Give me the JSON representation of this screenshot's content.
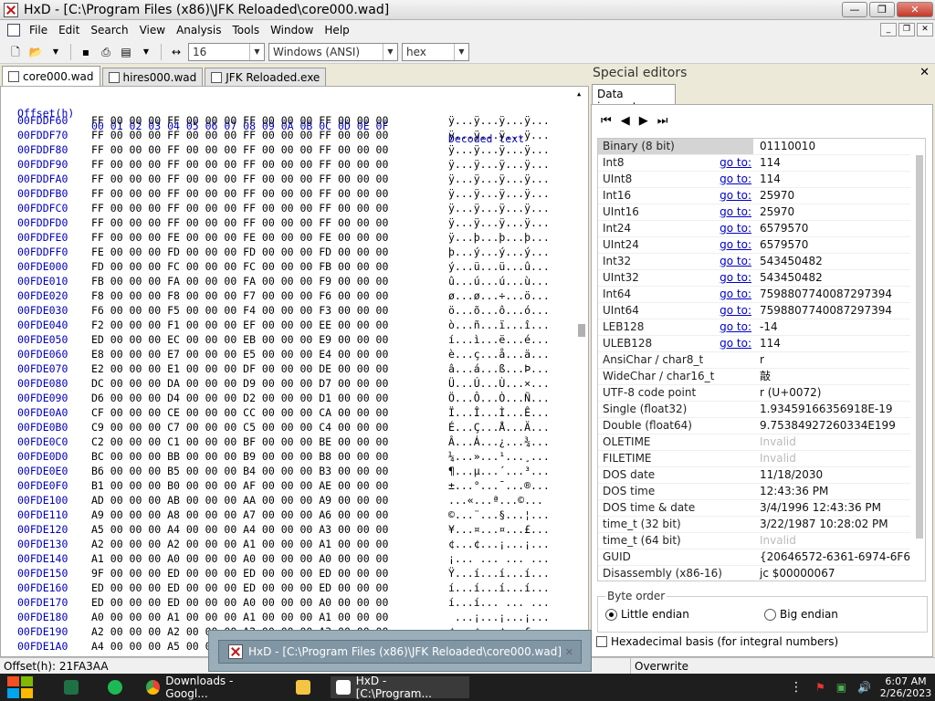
{
  "window": {
    "title": "HxD - [C:\\Program Files (x86)\\JFK Reloaded\\core000.wad]"
  },
  "menu": [
    "File",
    "Edit",
    "Search",
    "View",
    "Analysis",
    "Tools",
    "Window",
    "Help"
  ],
  "toolbar": {
    "bytes_per_row": "16",
    "charset": "Windows (ANSI)",
    "offset_base": "hex"
  },
  "tabs": [
    "core000.wad",
    "hires000.wad",
    "JFK Reloaded.exe"
  ],
  "hex": {
    "header_offset": "Offset(h)",
    "header_columns": "00 01 02 03 04 05 06 07 08 09 0A 0B 0C 0D 0E 0F",
    "header_decoded": "Decoded text",
    "rows": [
      {
        "o": "00FDDF60",
        "b": "FF 00 00 00 FF 00 00 00 FF 00 00 00 FF 00 00 00",
        "d": "ÿ...ÿ...ÿ...ÿ..."
      },
      {
        "o": "00FDDF70",
        "b": "FF 00 00 00 FF 00 00 00 FF 00 00 00 FF 00 00 00",
        "d": "ÿ...ÿ...ÿ...ÿ..."
      },
      {
        "o": "00FDDF80",
        "b": "FF 00 00 00 FF 00 00 00 FF 00 00 00 FF 00 00 00",
        "d": "ÿ...ÿ...ÿ...ÿ..."
      },
      {
        "o": "00FDDF90",
        "b": "FF 00 00 00 FF 00 00 00 FF 00 00 00 FF 00 00 00",
        "d": "ÿ...ÿ...ÿ...ÿ..."
      },
      {
        "o": "00FDDFA0",
        "b": "FF 00 00 00 FF 00 00 00 FF 00 00 00 FF 00 00 00",
        "d": "ÿ...ÿ...ÿ...ÿ..."
      },
      {
        "o": "00FDDFB0",
        "b": "FF 00 00 00 FF 00 00 00 FF 00 00 00 FF 00 00 00",
        "d": "ÿ...ÿ...ÿ...ÿ..."
      },
      {
        "o": "00FDDFC0",
        "b": "FF 00 00 00 FF 00 00 00 FF 00 00 00 FF 00 00 00",
        "d": "ÿ...ÿ...ÿ...ÿ..."
      },
      {
        "o": "00FDDFD0",
        "b": "FF 00 00 00 FF 00 00 00 FF 00 00 00 FF 00 00 00",
        "d": "ÿ...ÿ...ÿ...ÿ..."
      },
      {
        "o": "00FDDFE0",
        "b": "FF 00 00 00 FE 00 00 00 FE 00 00 00 FE 00 00 00",
        "d": "ÿ...þ...þ...þ..."
      },
      {
        "o": "00FDDFF0",
        "b": "FE 00 00 00 FD 00 00 00 FD 00 00 00 FD 00 00 00",
        "d": "þ...ý...ý...ý..."
      },
      {
        "o": "00FDE000",
        "b": "FD 00 00 00 FC 00 00 00 FC 00 00 00 FB 00 00 00",
        "d": "ý...ü...ü...û..."
      },
      {
        "o": "00FDE010",
        "b": "FB 00 00 00 FA 00 00 00 FA 00 00 00 F9 00 00 00",
        "d": "û...ú...ú...ù..."
      },
      {
        "o": "00FDE020",
        "b": "F8 00 00 00 F8 00 00 00 F7 00 00 00 F6 00 00 00",
        "d": "ø...ø...÷...ö..."
      },
      {
        "o": "00FDE030",
        "b": "F6 00 00 00 F5 00 00 00 F4 00 00 00 F3 00 00 00",
        "d": "ö...õ...ô...ó..."
      },
      {
        "o": "00FDE040",
        "b": "F2 00 00 00 F1 00 00 00 EF 00 00 00 EE 00 00 00",
        "d": "ò...ñ...ï...î..."
      },
      {
        "o": "00FDE050",
        "b": "ED 00 00 00 EC 00 00 00 EB 00 00 00 E9 00 00 00",
        "d": "í...ì...ë...é..."
      },
      {
        "o": "00FDE060",
        "b": "E8 00 00 00 E7 00 00 00 E5 00 00 00 E4 00 00 00",
        "d": "è...ç...å...ä..."
      },
      {
        "o": "00FDE070",
        "b": "E2 00 00 00 E1 00 00 00 DF 00 00 00 DE 00 00 00",
        "d": "â...á...ß...Þ..."
      },
      {
        "o": "00FDE080",
        "b": "DC 00 00 00 DA 00 00 00 D9 00 00 00 D7 00 00 00",
        "d": "Ü...Ú...Ù...×..."
      },
      {
        "o": "00FDE090",
        "b": "D6 00 00 00 D4 00 00 00 D2 00 00 00 D1 00 00 00",
        "d": "Ö...Ô...Ò...Ñ..."
      },
      {
        "o": "00FDE0A0",
        "b": "CF 00 00 00 CE 00 00 00 CC 00 00 00 CA 00 00 00",
        "d": "Ï...Î...Ì...Ê..."
      },
      {
        "o": "00FDE0B0",
        "b": "C9 00 00 00 C7 00 00 00 C5 00 00 00 C4 00 00 00",
        "d": "É...Ç...Å...Ä..."
      },
      {
        "o": "00FDE0C0",
        "b": "C2 00 00 00 C1 00 00 00 BF 00 00 00 BE 00 00 00",
        "d": "Â...Á...¿...¾..."
      },
      {
        "o": "00FDE0D0",
        "b": "BC 00 00 00 BB 00 00 00 B9 00 00 00 B8 00 00 00",
        "d": "¼...»...¹...¸..."
      },
      {
        "o": "00FDE0E0",
        "b": "B6 00 00 00 B5 00 00 00 B4 00 00 00 B3 00 00 00",
        "d": "¶...µ...´...³..."
      },
      {
        "o": "00FDE0F0",
        "b": "B1 00 00 00 B0 00 00 00 AF 00 00 00 AE 00 00 00",
        "d": "±...°...¯...®..."
      },
      {
        "o": "00FDE100",
        "b": "AD 00 00 00 AB 00 00 00 AA 00 00 00 A9 00 00 00",
        "d": "­...«...ª...©..."
      },
      {
        "o": "00FDE110",
        "b": "A9 00 00 00 A8 00 00 00 A7 00 00 00 A6 00 00 00",
        "d": "©...¨...§...¦..."
      },
      {
        "o": "00FDE120",
        "b": "A5 00 00 00 A4 00 00 00 A4 00 00 00 A3 00 00 00",
        "d": "¥...¤...¤...£..."
      },
      {
        "o": "00FDE130",
        "b": "A2 00 00 00 A2 00 00 00 A1 00 00 00 A1 00 00 00",
        "d": "¢...¢...¡...¡..."
      },
      {
        "o": "00FDE140",
        "b": "A1 00 00 00 A0 00 00 00 A0 00 00 00 A0 00 00 00",
        "d": "¡... ... ... ..."
      },
      {
        "o": "00FDE150",
        "b": "9F 00 00 00 ED 00 00 00 ED 00 00 00 ED 00 00 00",
        "d": "Ÿ...í...í...í..."
      },
      {
        "o": "00FDE160",
        "b": "ED 00 00 00 ED 00 00 00 ED 00 00 00 ED 00 00 00",
        "d": "í...í...í...í..."
      },
      {
        "o": "00FDE170",
        "b": "ED 00 00 00 ED 00 00 00 A0 00 00 00 A0 00 00 00",
        "d": "í...í... ... ..."
      },
      {
        "o": "00FDE180",
        "b": "A0 00 00 00 A1 00 00 00 A1 00 00 00 A1 00 00 00",
        "d": " ...¡...¡...¡..."
      },
      {
        "o": "00FDE190",
        "b": "A2 00 00 00 A2 00 00 00 A2 00 00 00 A3 00 00 00",
        "d": "¢...¢...¢...£..."
      },
      {
        "o": "00FDE1A0",
        "b": "A4 00 00 00 A5 00 00 00 A5 00 00 00 A6 00 00 00",
        "d": "¤...¥...¥...¦..."
      }
    ]
  },
  "special_editors": {
    "title": "Special editors",
    "tab": "Data inspector",
    "goto_label": "go to:",
    "rows": [
      {
        "name": "Binary (8 bit)",
        "value": "01110010",
        "goto": false
      },
      {
        "name": "Int8",
        "value": "114",
        "goto": true
      },
      {
        "name": "UInt8",
        "value": "114",
        "goto": true
      },
      {
        "name": "Int16",
        "value": "25970",
        "goto": true
      },
      {
        "name": "UInt16",
        "value": "25970",
        "goto": true
      },
      {
        "name": "Int24",
        "value": "6579570",
        "goto": true
      },
      {
        "name": "UInt24",
        "value": "6579570",
        "goto": true
      },
      {
        "name": "Int32",
        "value": "543450482",
        "goto": true
      },
      {
        "name": "UInt32",
        "value": "543450482",
        "goto": true
      },
      {
        "name": "Int64",
        "value": "7598807740087297394",
        "goto": true
      },
      {
        "name": "UInt64",
        "value": "7598807740087297394",
        "goto": true
      },
      {
        "name": "LEB128",
        "value": "-14",
        "goto": true
      },
      {
        "name": "ULEB128",
        "value": "114",
        "goto": true
      },
      {
        "name": "AnsiChar / char8_t",
        "value": "r",
        "goto": false
      },
      {
        "name": "WideChar / char16_t",
        "value": "敲",
        "goto": false
      },
      {
        "name": "UTF-8 code point",
        "value": "r (U+0072)",
        "goto": false
      },
      {
        "name": "Single (float32)",
        "value": "1.93459166356918E-19",
        "goto": false
      },
      {
        "name": "Double (float64)",
        "value": "9.75384927260334E199",
        "goto": false
      },
      {
        "name": "OLETIME",
        "value": "Invalid",
        "goto": false,
        "dim": true
      },
      {
        "name": "FILETIME",
        "value": "Invalid",
        "goto": false,
        "dim": true
      },
      {
        "name": "DOS date",
        "value": "11/18/2030",
        "goto": false
      },
      {
        "name": "DOS time",
        "value": "12:43:36 PM",
        "goto": false
      },
      {
        "name": "DOS time & date",
        "value": "3/4/1996 12:43:36 PM",
        "goto": false
      },
      {
        "name": "time_t (32 bit)",
        "value": "3/22/1987 10:28:02 PM",
        "goto": false
      },
      {
        "name": "time_t (64 bit)",
        "value": "Invalid",
        "goto": false,
        "dim": true
      },
      {
        "name": "GUID",
        "value": "{20646572-6361-6974-6F6E-",
        "goto": false
      },
      {
        "name": "Disassembly (x86-16)",
        "value": "jc $00000067",
        "goto": false
      }
    ],
    "byte_order_label": "Byte order",
    "little_endian": "Little endian",
    "big_endian": "Big endian",
    "hex_basis": "Hexadecimal basis (for integral numbers)"
  },
  "status": {
    "offset": "Offset(h): 21FA3AA",
    "mode": "Overwrite"
  },
  "tooltip": {
    "text": "HxD - [C:\\Program Files (x86)\\JFK Reloaded\\core000.wad]"
  },
  "taskbar": {
    "apps": [
      {
        "label": "Downloads - Googl...",
        "icon_color": "#dd4b39"
      },
      {
        "label": "HxD - [C:\\Program...",
        "icon_color": "#ffffff"
      }
    ],
    "time": "6:07 AM",
    "date": "2/26/2023"
  }
}
